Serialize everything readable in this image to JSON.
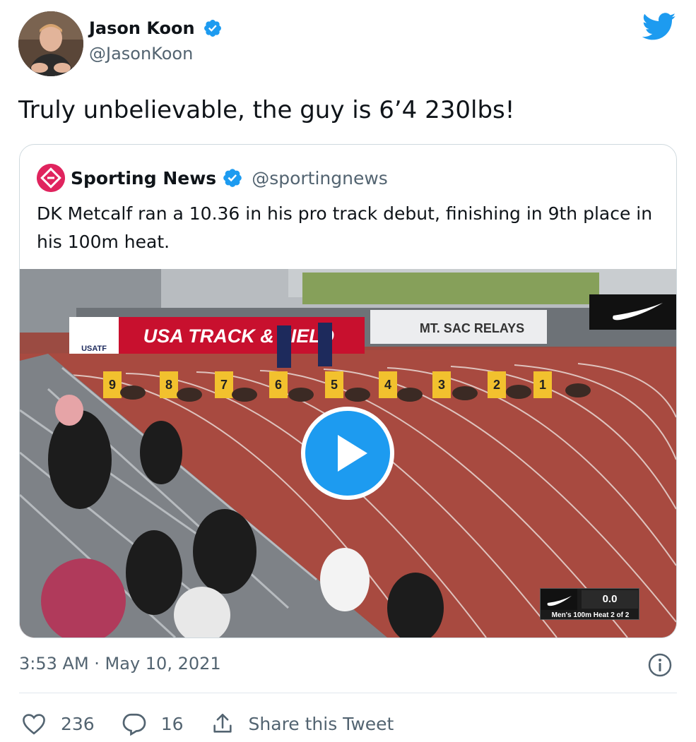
{
  "author": {
    "name": "Jason Koon",
    "handle": "@JasonKoon"
  },
  "tweet": {
    "text": "Truly unbelievable, the guy is 6’4 230lbs!"
  },
  "quoted": {
    "name": "Sporting News",
    "handle": "@sportingnews",
    "text": "DK Metcalf ran a 10.36 in his pro track debut, finishing in 9th place in his 100m heat.",
    "media": {
      "scoreboard_time": "0.0",
      "scoreboard_caption": "Men's 100m Heat 2 of 2",
      "banners": [
        "USA TRACK & FIELD",
        "USATF",
        "MT. SAC RELAYS"
      ],
      "lane_numbers": [
        "9",
        "8",
        "7",
        "6",
        "5",
        "4",
        "3",
        "2",
        "1"
      ]
    }
  },
  "meta": {
    "timestamp": "3:53 AM · May 10, 2021"
  },
  "actions": {
    "likes": "236",
    "replies": "16",
    "share_label": "Share this Tweet"
  },
  "icons": {
    "verified": "verified-badge-icon",
    "bird": "twitter-bird-icon",
    "info": "info-icon",
    "like": "heart-icon",
    "reply": "reply-bubble-icon",
    "share": "share-icon",
    "play": "play-icon"
  },
  "colors": {
    "accent": "#1d9bf0",
    "text": "#0f1419",
    "muted": "#536471",
    "border": "#cfd9de",
    "brand_logo": "#e0245e"
  }
}
